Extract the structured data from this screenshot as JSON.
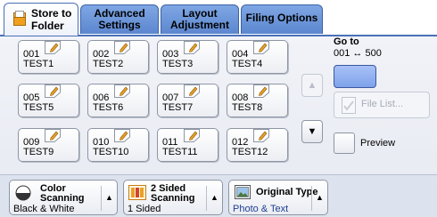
{
  "tabs": [
    {
      "label_line1": "Store to",
      "label_line2": "Folder",
      "icon": "folder-icon",
      "active": true
    },
    {
      "label_line1": "Advanced",
      "label_line2": "Settings",
      "active": false
    },
    {
      "label_line1": "Layout",
      "label_line2": "Adjustment",
      "active": false
    },
    {
      "label": "Filing Options",
      "active": false
    }
  ],
  "folders": [
    {
      "number": "001",
      "name": "TEST1"
    },
    {
      "number": "002",
      "name": "TEST2"
    },
    {
      "number": "003",
      "name": "TEST3"
    },
    {
      "number": "004",
      "name": "TEST4"
    },
    {
      "number": "005",
      "name": "TEST5"
    },
    {
      "number": "006",
      "name": "TEST6"
    },
    {
      "number": "007",
      "name": "TEST7"
    },
    {
      "number": "008",
      "name": "TEST8"
    },
    {
      "number": "009",
      "name": "TEST9"
    },
    {
      "number": "010",
      "name": "TEST10"
    },
    {
      "number": "011",
      "name": "TEST11"
    },
    {
      "number": "012",
      "name": "TEST12"
    }
  ],
  "goto": {
    "label": "Go to",
    "range": "001 ↔ 500",
    "value": ""
  },
  "scroll": {
    "up_glyph": "▲",
    "down_glyph": "▼"
  },
  "file_list": {
    "label": "File List..."
  },
  "preview": {
    "label": "Preview"
  },
  "features": [
    {
      "title_line1": "Color",
      "title_line2": "Scanning",
      "value": "Black & White",
      "icon": "color-circle-icon"
    },
    {
      "title_line1": "2 Sided",
      "title_line2": "Scanning",
      "value": "1 Sided",
      "icon": "two-sided-icon"
    },
    {
      "title_line1": "Original Type",
      "title_line2": "",
      "value": "Photo & Text",
      "icon": "photo-icon"
    }
  ],
  "feature_arrow": "▲",
  "colors": {
    "tab_blue": "#6b93d8",
    "goto_blue": "#8eaef0",
    "accent_orange": "#e8a126",
    "value_blue": "#1f3f93"
  }
}
